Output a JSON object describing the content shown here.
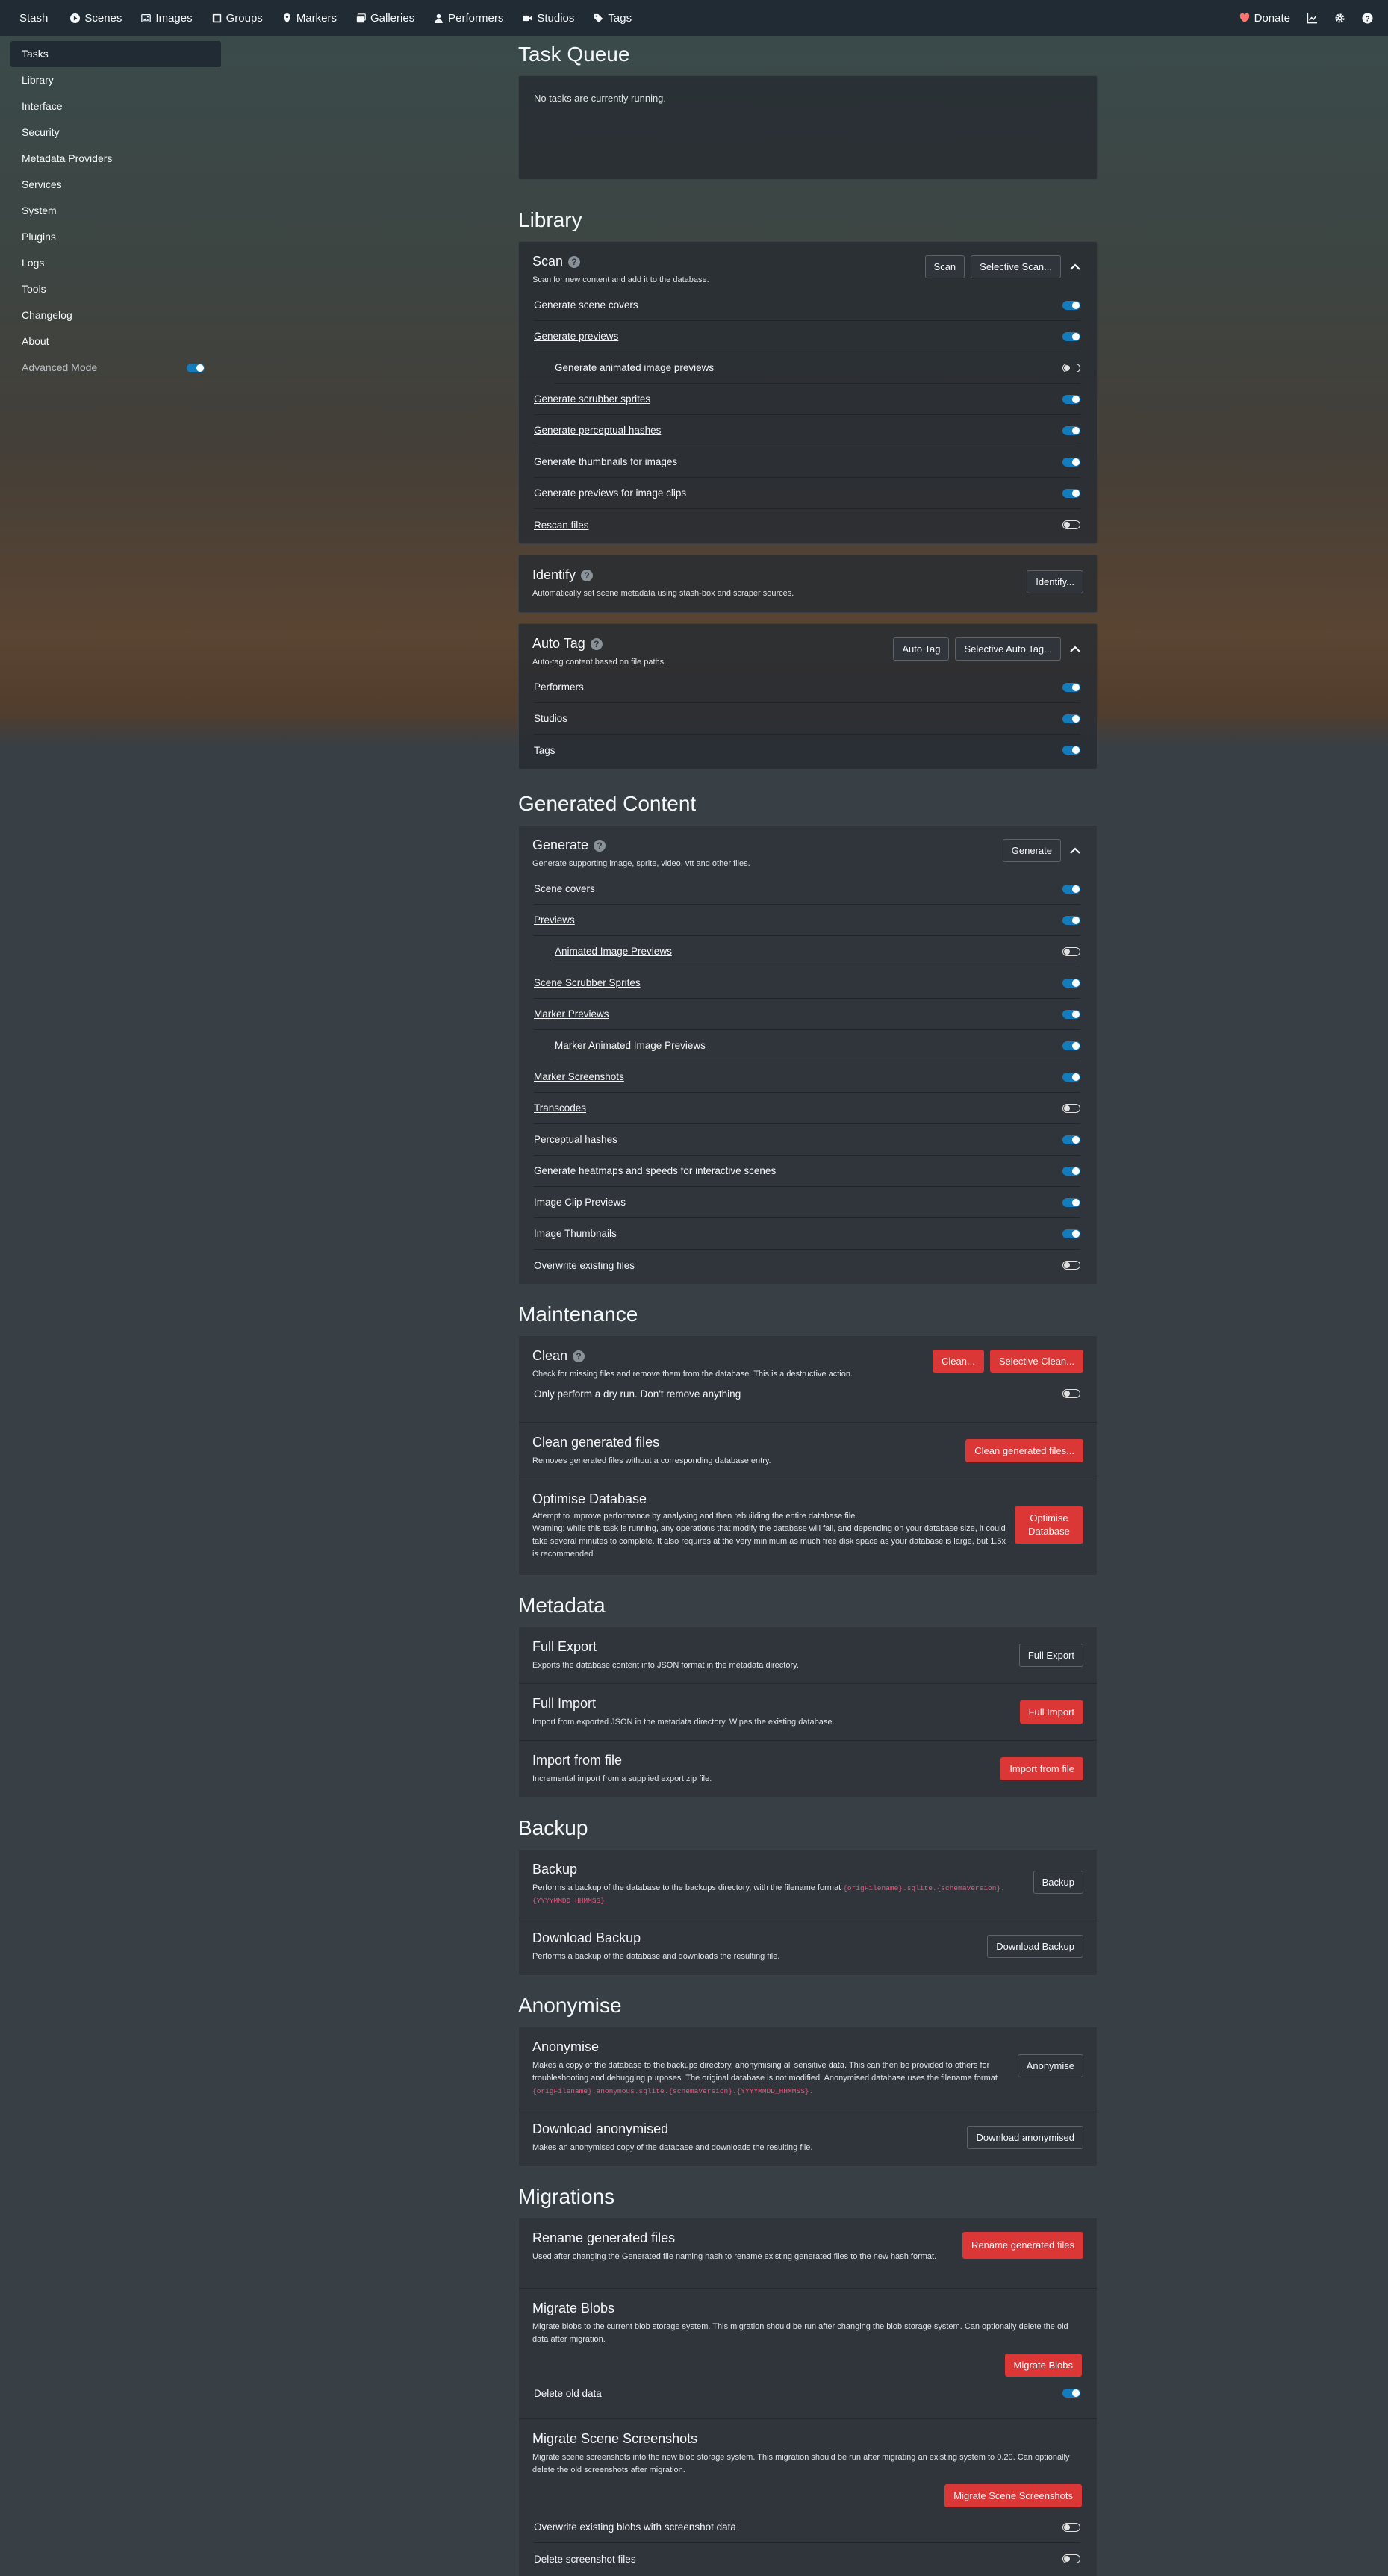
{
  "navbar": {
    "brand": "Stash",
    "items": [
      {
        "label": "Scenes",
        "icon": "play-circle-icon"
      },
      {
        "label": "Images",
        "icon": "image-icon"
      },
      {
        "label": "Groups",
        "icon": "film-icon"
      },
      {
        "label": "Markers",
        "icon": "map-marker-icon"
      },
      {
        "label": "Galleries",
        "icon": "images-icon"
      },
      {
        "label": "Performers",
        "icon": "user-icon"
      },
      {
        "label": "Studios",
        "icon": "video-icon"
      },
      {
        "label": "Tags",
        "icon": "tag-icon"
      }
    ],
    "donate": "Donate"
  },
  "sidebar": {
    "items": [
      "Tasks",
      "Library",
      "Interface",
      "Security",
      "Metadata Providers",
      "Services",
      "System",
      "Plugins",
      "Logs",
      "Tools",
      "Changelog",
      "About"
    ],
    "advanced_mode": "Advanced Mode"
  },
  "task_queue": {
    "heading": "Task Queue",
    "empty": "No tasks are currently running."
  },
  "library": {
    "heading": "Library",
    "scan": {
      "title": "Scan",
      "desc": "Scan for new content and add it to the database.",
      "btn_scan": "Scan",
      "btn_selective": "Selective Scan...",
      "options": [
        {
          "label": "Generate scene covers",
          "on": true,
          "u": false,
          "ind": false
        },
        {
          "label": "Generate previews",
          "on": true,
          "u": true,
          "ind": false
        },
        {
          "label": "Generate animated image previews",
          "on": false,
          "u": true,
          "ind": true
        },
        {
          "label": "Generate scrubber sprites",
          "on": true,
          "u": true,
          "ind": false
        },
        {
          "label": "Generate perceptual hashes",
          "on": true,
          "u": true,
          "ind": false
        },
        {
          "label": "Generate thumbnails for images",
          "on": true,
          "u": false,
          "ind": false
        },
        {
          "label": "Generate previews for image clips",
          "on": true,
          "u": false,
          "ind": false
        },
        {
          "label": "Rescan files",
          "on": false,
          "u": true,
          "ind": false
        }
      ]
    },
    "identify": {
      "title": "Identify",
      "desc": "Automatically set scene metadata using stash-box and scraper sources.",
      "btn": "Identify..."
    },
    "autotag": {
      "title": "Auto Tag",
      "desc": "Auto-tag content based on file paths.",
      "btn": "Auto Tag",
      "btn_selective": "Selective Auto Tag...",
      "options": [
        {
          "label": "Performers",
          "on": true
        },
        {
          "label": "Studios",
          "on": true
        },
        {
          "label": "Tags",
          "on": true
        }
      ]
    }
  },
  "generated": {
    "heading": "Generated Content",
    "title": "Generate",
    "desc": "Generate supporting image, sprite, video, vtt and other files.",
    "btn": "Generate",
    "options": [
      {
        "label": "Scene covers",
        "on": true,
        "u": false,
        "ind": false
      },
      {
        "label": "Previews",
        "on": true,
        "u": true,
        "ind": false
      },
      {
        "label": "Animated Image Previews",
        "on": false,
        "u": true,
        "ind": true
      },
      {
        "label": "Scene Scrubber Sprites",
        "on": true,
        "u": true,
        "ind": false
      },
      {
        "label": "Marker Previews",
        "on": true,
        "u": true,
        "ind": false
      },
      {
        "label": "Marker Animated Image Previews",
        "on": true,
        "u": true,
        "ind": true
      },
      {
        "label": "Marker Screenshots",
        "on": true,
        "u": true,
        "ind": false
      },
      {
        "label": "Transcodes",
        "on": false,
        "u": true,
        "ind": false
      },
      {
        "label": "Perceptual hashes",
        "on": true,
        "u": true,
        "ind": false
      },
      {
        "label": "Generate heatmaps and speeds for interactive scenes",
        "on": true,
        "u": false,
        "ind": false
      },
      {
        "label": "Image Clip Previews",
        "on": true,
        "u": false,
        "ind": false
      },
      {
        "label": "Image Thumbnails",
        "on": true,
        "u": false,
        "ind": false
      },
      {
        "label": "Overwrite existing files",
        "on": false,
        "u": false,
        "ind": false
      }
    ]
  },
  "maintenance": {
    "heading": "Maintenance",
    "clean": {
      "title": "Clean",
      "desc": "Check for missing files and remove them from the database. This is a destructive action.",
      "btn_clean": "Clean...",
      "btn_selective": "Selective Clean...",
      "dry_run": "Only perform a dry run. Don't remove anything"
    },
    "clean_generated": {
      "title": "Clean generated files",
      "desc": "Removes generated files without a corresponding database entry.",
      "btn": "Clean generated files..."
    },
    "optimise": {
      "title": "Optimise Database",
      "desc1": "Attempt to improve performance by analysing and then rebuilding the entire database file.",
      "desc2": "Warning: while this task is running, any operations that modify the database will fail, and depending on your database size, it could take several minutes to complete. It also requires at the very minimum as much free disk space as your database is large, but 1.5x is recommended.",
      "btn": "Optimise Database"
    }
  },
  "metadata": {
    "heading": "Metadata",
    "full_export": {
      "title": "Full Export",
      "desc": "Exports the database content into JSON format in the metadata directory.",
      "btn": "Full Export"
    },
    "full_import": {
      "title": "Full Import",
      "desc": "Import from exported JSON in the metadata directory. Wipes the existing database.",
      "btn": "Full Import"
    },
    "import_file": {
      "title": "Import from file",
      "desc": "Incremental import from a supplied export zip file.",
      "btn": "Import from file"
    }
  },
  "backup": {
    "heading": "Backup",
    "backup": {
      "title": "Backup",
      "desc": "Performs a backup of the database to the backups directory, with the filename format",
      "format": "{origFilename}.sqlite.{schemaVersion}.{YYYYMMDD_HHMMSS}",
      "btn": "Backup"
    },
    "download": {
      "title": "Download Backup",
      "desc": "Performs a backup of the database and downloads the resulting file.",
      "btn": "Download Backup"
    }
  },
  "anonymise": {
    "heading": "Anonymise",
    "anonymise": {
      "title": "Anonymise",
      "desc": "Makes a copy of the database to the backups directory, anonymising all sensitive data. This can then be provided to others for troubleshooting and debugging purposes. The original database is not modified. Anonymised database uses the filename format",
      "format": "{origFilename}.anonymous.sqlite.{schemaVersion}.{YYYYMMDD_HHMMSS}.",
      "btn": "Anonymise"
    },
    "download": {
      "title": "Download anonymised",
      "desc": "Makes an anonymised copy of the database and downloads the resulting file.",
      "btn": "Download anonymised"
    }
  },
  "migrations": {
    "heading": "Migrations",
    "rename": {
      "title": "Rename generated files",
      "desc": "Used after changing the Generated file naming hash to rename existing generated files to the new hash format.",
      "btn": "Rename generated files"
    },
    "blobs": {
      "title": "Migrate Blobs",
      "desc": "Migrate blobs to the current blob storage system. This migration should be run after changing the blob storage system. Can optionally delete the old data after migration.",
      "btn": "Migrate Blobs",
      "option": "Delete old data",
      "option_on": true
    },
    "screenshots": {
      "title": "Migrate Scene Screenshots",
      "desc": "Migrate scene screenshots into the new blob storage system. This migration should be run after migrating an existing system to 0.20. Can optionally delete the old screenshots after migration.",
      "btn": "Migrate Scene Screenshots",
      "options": [
        {
          "label": "Overwrite existing blobs with screenshot data",
          "on": false
        },
        {
          "label": "Delete screenshot files",
          "on": false
        }
      ]
    }
  },
  "colors": {
    "navbar": "#202b33",
    "accent": "#137cbd",
    "danger": "#db3737",
    "card": "#30353b",
    "background": "#394045"
  }
}
